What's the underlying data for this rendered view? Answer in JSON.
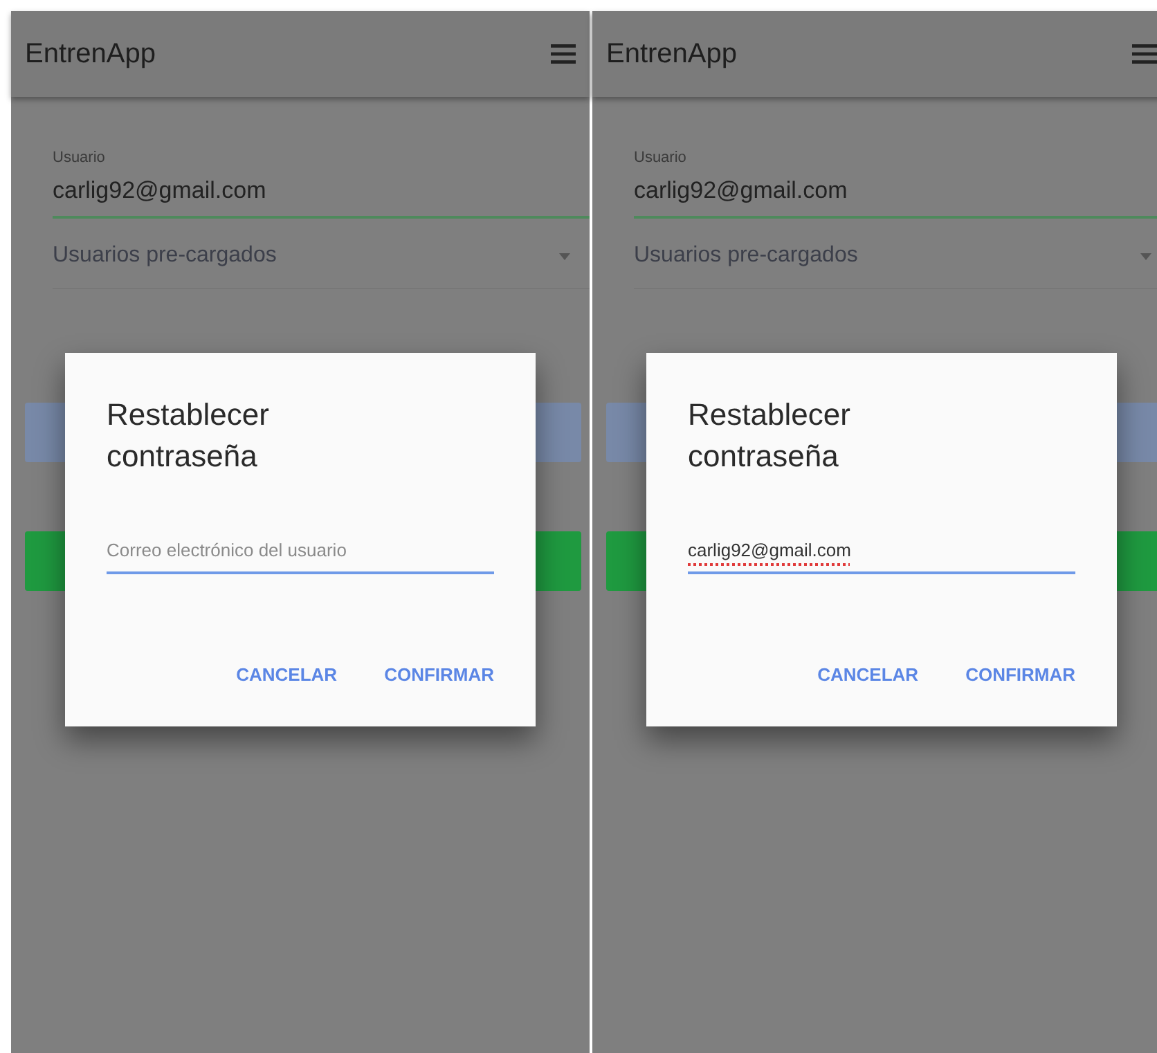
{
  "screens": [
    {
      "app_title": "EntrenApp",
      "username_label": "Usuario",
      "username_value": "carlig92@gmail.com",
      "select_placeholder": "Usuarios pre-cargados",
      "dialog": {
        "title": "Restablecer contraseña",
        "field": {
          "placeholder": "Correo electrónico del usuario",
          "spellcheck_error": false
        },
        "buttons": [
          "CANCELAR",
          "CONFIRMAR"
        ]
      }
    },
    {
      "app_title": "EntrenApp",
      "username_label": "Usuario",
      "username_value": "carlig92@gmail.com",
      "select_placeholder": "Usuarios pre-cargados",
      "dialog": {
        "title": "Restablecer contraseña",
        "field": {
          "value": "carlig92@gmail.com",
          "spellcheck_error": true
        },
        "buttons": [
          "CANCELAR",
          "CONFIRMAR"
        ]
      }
    }
  ]
}
